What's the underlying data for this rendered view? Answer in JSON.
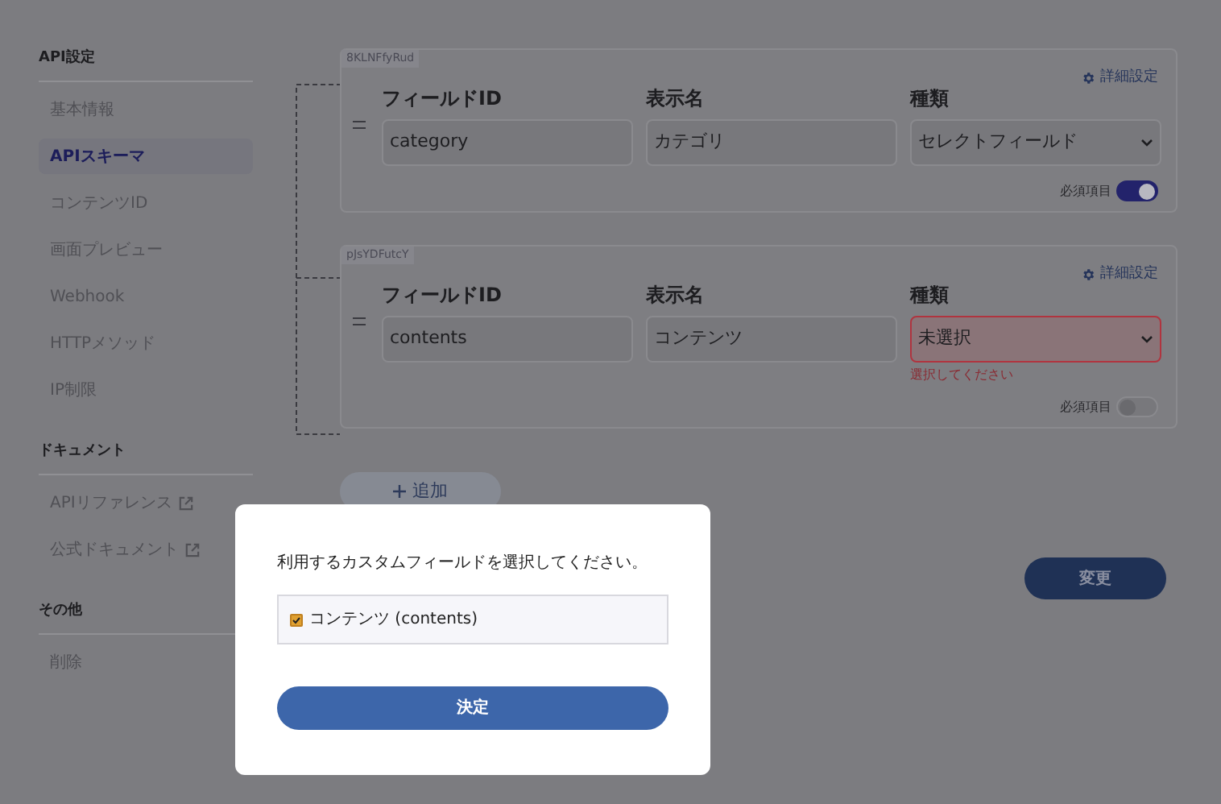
{
  "sidebar": [
    {
      "title": "API設定",
      "items": [
        {
          "label": "基本情報",
          "selected": false,
          "external": false
        },
        {
          "label": "APIスキーマ",
          "selected": true,
          "external": false
        },
        {
          "label": "コンテンツID",
          "selected": false,
          "external": false
        },
        {
          "label": "画面プレビュー",
          "selected": false,
          "external": false
        },
        {
          "label": "Webhook",
          "selected": false,
          "external": false
        },
        {
          "label": "HTTPメソッド",
          "selected": false,
          "external": false
        },
        {
          "label": "IP制限",
          "selected": false,
          "external": false
        }
      ]
    },
    {
      "title": "ドキュメント",
      "items": [
        {
          "label": "APIリファレンス",
          "selected": false,
          "external": true
        },
        {
          "label": "公式ドキュメント",
          "selected": false,
          "external": true
        }
      ]
    },
    {
      "title": "その他",
      "items": [
        {
          "label": "削除",
          "selected": false,
          "external": false
        }
      ]
    }
  ],
  "fields": [
    {
      "tag": "8KLNFfyRud",
      "settings": "詳細設定",
      "id_label": "フィールドID",
      "id_value": "category",
      "name_label": "表示名",
      "name_value": "カテゴリ",
      "type_label": "種類",
      "type_value": "セレクトフィールド",
      "required_label": "必須項目",
      "required": true
    },
    {
      "tag": "pJsYDFutcY",
      "settings": "詳細設定",
      "id_label": "フィールドID",
      "id_value": "contents",
      "name_label": "表示名",
      "name_value": "コンテンツ",
      "type_label": "種類",
      "type_value": "未選択",
      "error": "選択してください",
      "required_label": "必須項目",
      "required": false
    }
  ],
  "add_button": "追加",
  "change_button": "変更",
  "modal": {
    "message": "利用するカスタムフィールドを選択してください。",
    "options": [
      {
        "label": "コンテンツ (contents)",
        "checked": true
      }
    ],
    "confirm": "決定"
  }
}
